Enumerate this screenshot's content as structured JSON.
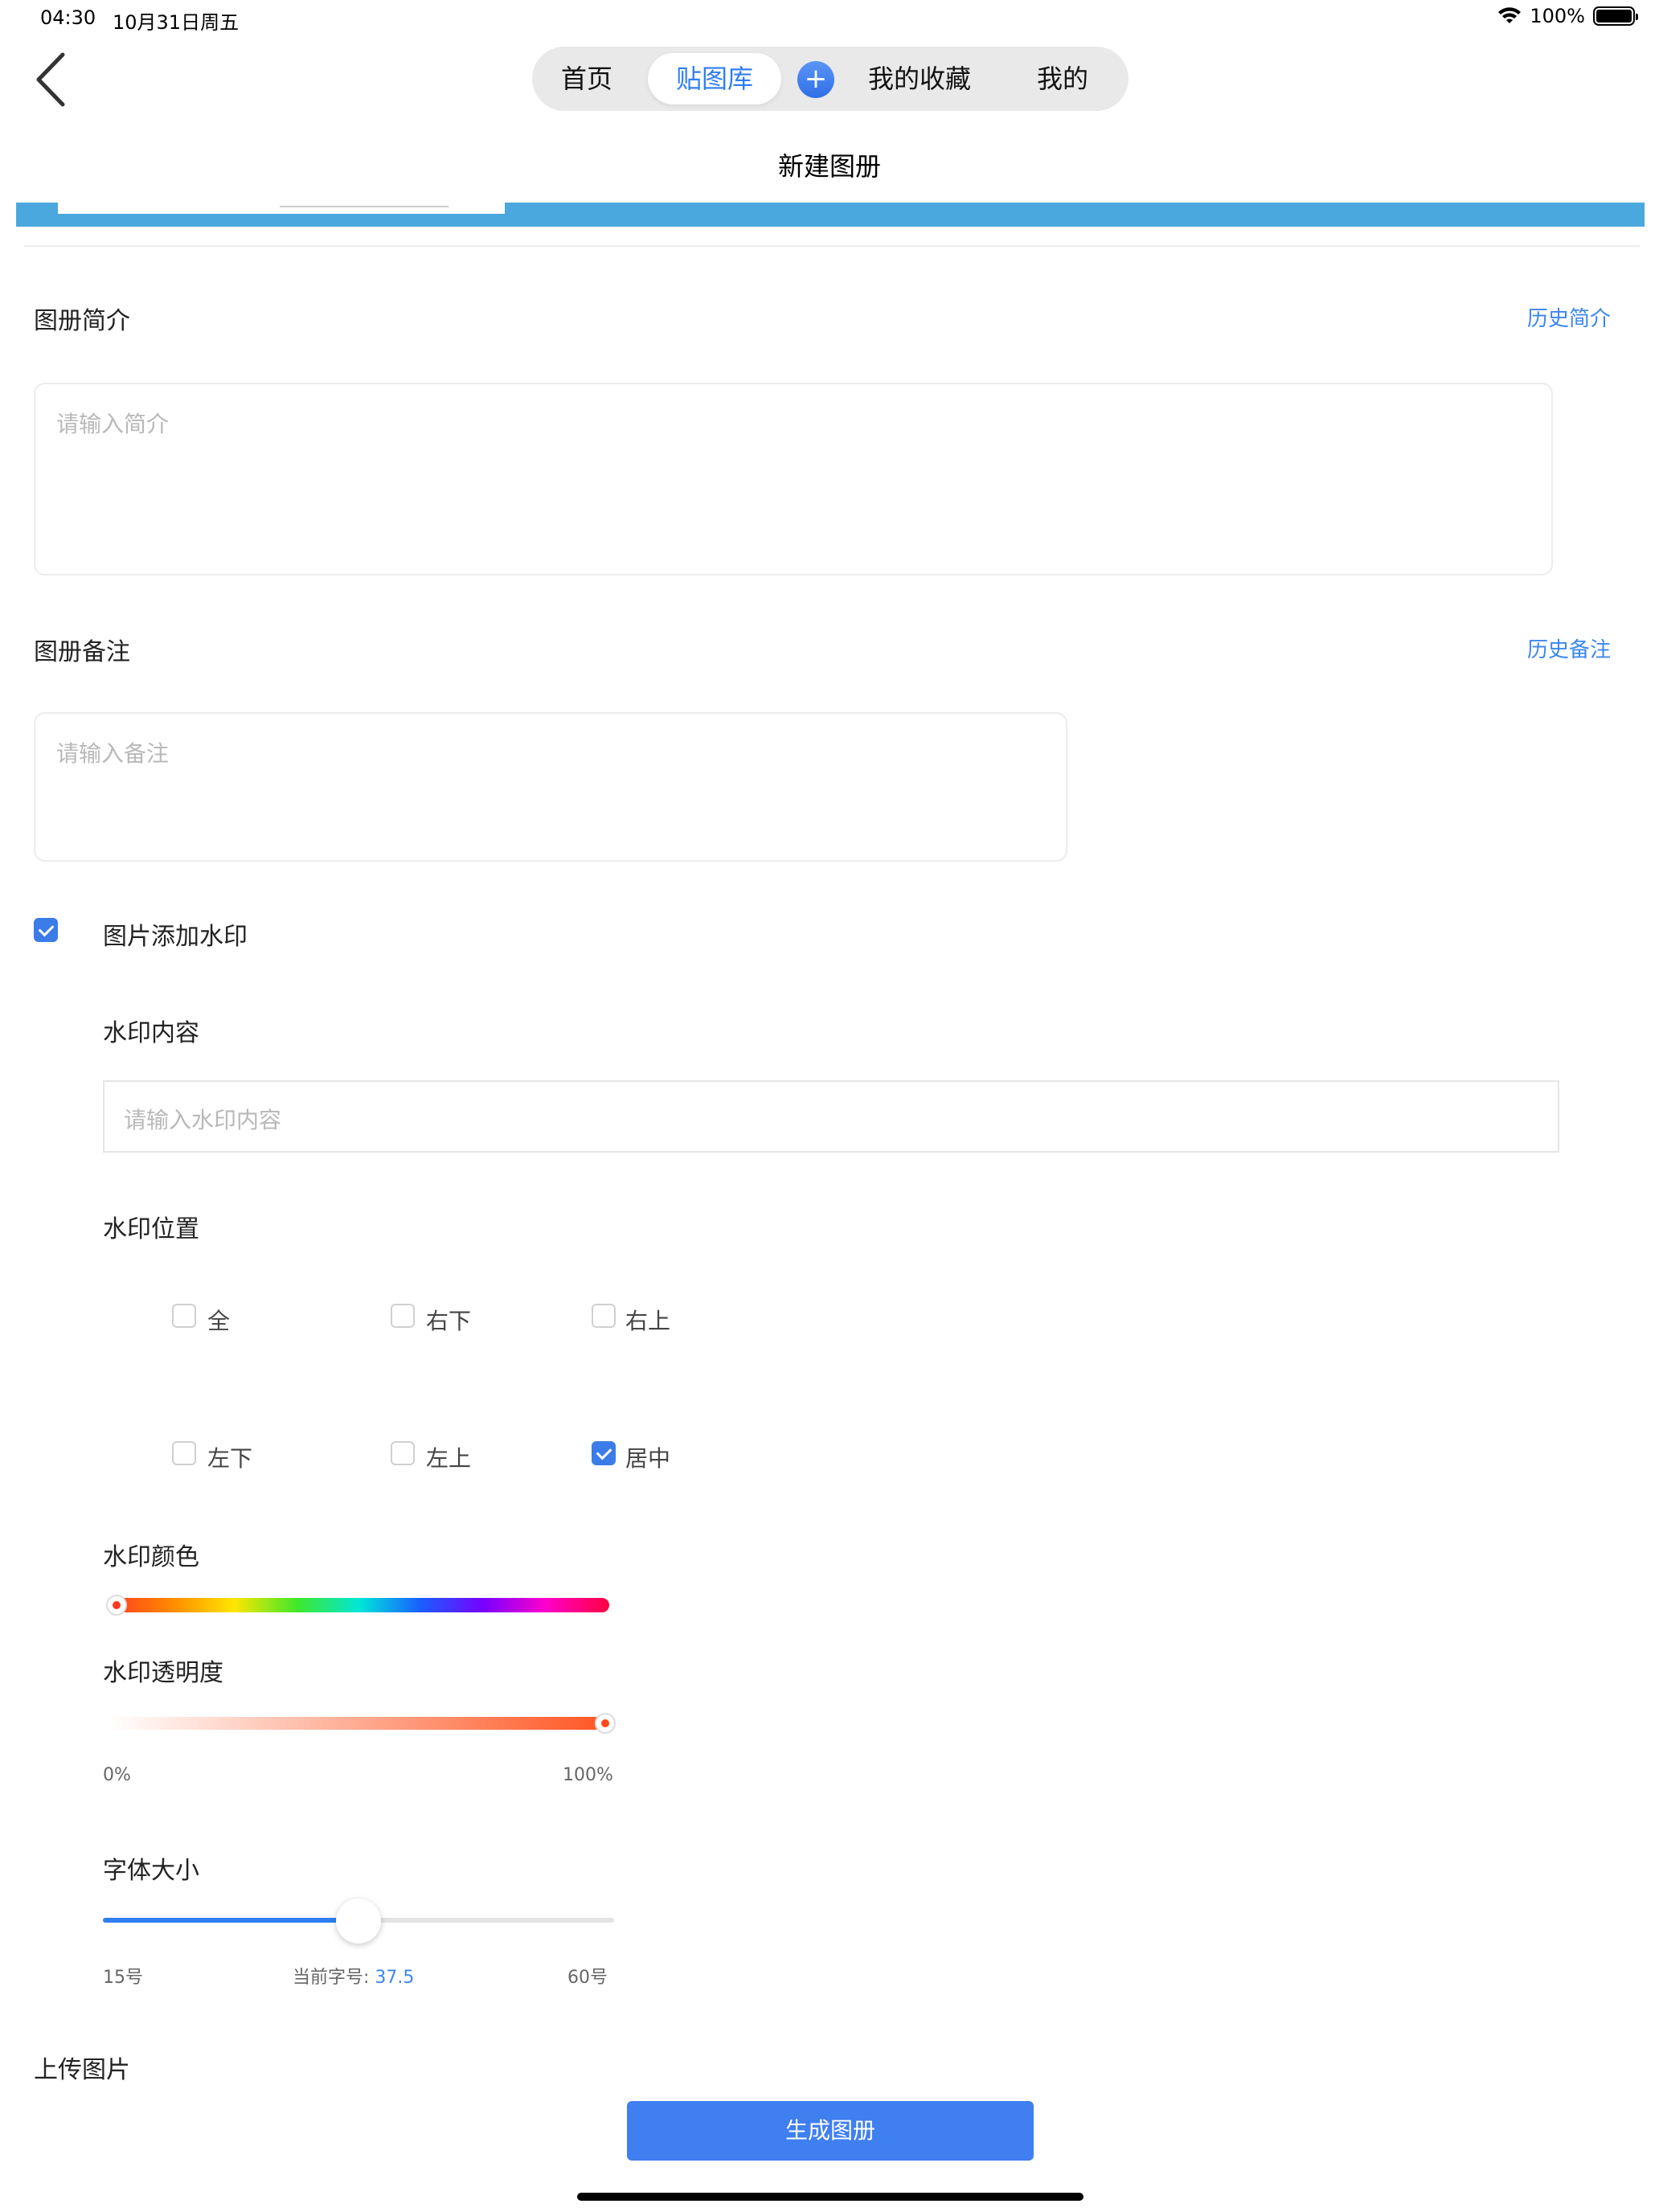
{
  "status_bar": {
    "time": "04:30",
    "date": "10月31日周五",
    "battery": "100%"
  },
  "nav": {
    "tabs": [
      "首页",
      "贴图库",
      "我的收藏",
      "我的"
    ],
    "active_tab": "贴图库",
    "plus": "+"
  },
  "page_title": "新建图册",
  "intro": {
    "label": "图册简介",
    "history_link": "历史简介",
    "placeholder": "请输入简介"
  },
  "note": {
    "label": "图册备注",
    "history_link": "历史备注",
    "placeholder": "请输入备注"
  },
  "watermark": {
    "enable_label": "图片添加水印",
    "enabled": true,
    "content_label": "水印内容",
    "content_placeholder": "请输入水印内容",
    "position_label": "水印位置",
    "positions": [
      {
        "label": "全",
        "checked": false
      },
      {
        "label": "右下",
        "checked": false
      },
      {
        "label": "右上",
        "checked": false
      },
      {
        "label": "左下",
        "checked": false
      },
      {
        "label": "左上",
        "checked": false
      },
      {
        "label": "居中",
        "checked": true
      }
    ],
    "color_label": "水印颜色",
    "color_value": "#ff3b1f",
    "opacity_label": "水印透明度",
    "opacity_min": "0%",
    "opacity_max": "100%",
    "opacity_value": 1.0,
    "font_size_label": "字体大小",
    "font_min": "15号",
    "font_max": "60号",
    "font_current_label": "当前字号:",
    "font_current_value": "37.5"
  },
  "upload_label": "上传图片",
  "submit_label": "生成图册",
  "colors": {
    "accent": "#3f7ff0",
    "link": "#3c87f0",
    "band": "#4aa8de"
  }
}
